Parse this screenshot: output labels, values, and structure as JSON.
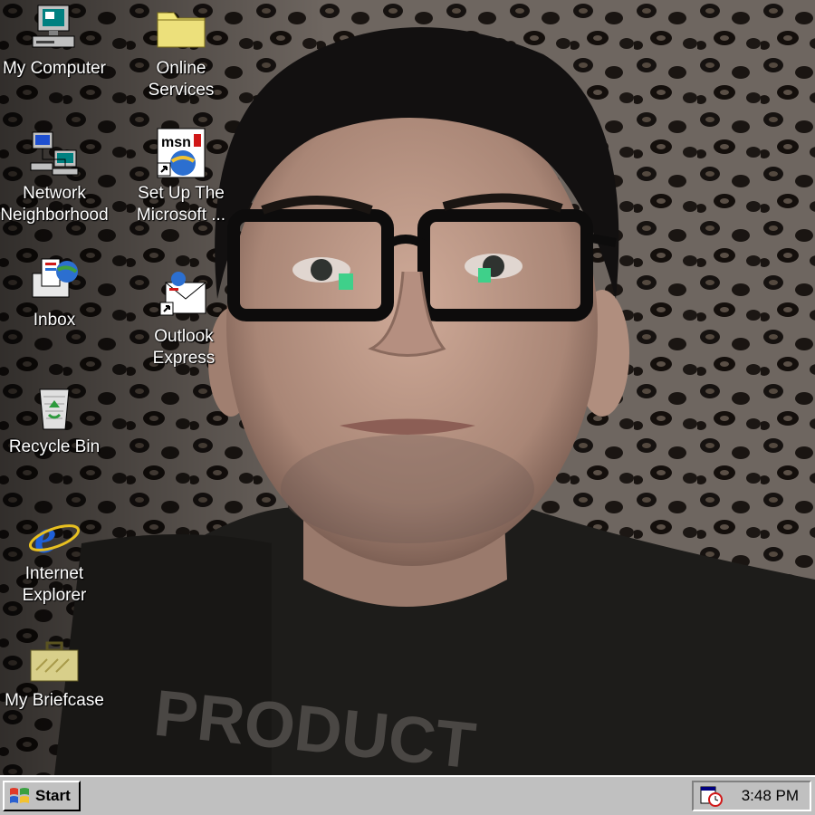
{
  "desktop": {
    "icons": [
      {
        "label_line1": "My Computer",
        "label_line2": "",
        "icon": "computer-icon"
      },
      {
        "label_line1": "Online",
        "label_line2": "Services",
        "icon": "folder-icon"
      },
      {
        "label_line1": "Network",
        "label_line2": "Neighborhood",
        "icon": "network-icon"
      },
      {
        "label_line1": "Set Up The",
        "label_line2": "Microsoft ...",
        "icon": "msn-icon"
      },
      {
        "label_line1": "Inbox",
        "label_line2": "",
        "icon": "inbox-icon"
      },
      {
        "label_line1": "Outlook",
        "label_line2": "Express",
        "icon": "outlook-express-icon"
      },
      {
        "label_line1": "Recycle Bin",
        "label_line2": "",
        "icon": "recycle-bin-icon"
      },
      {
        "label_line1": "Internet",
        "label_line2": "Explorer",
        "icon": "internet-explorer-icon"
      },
      {
        "label_line1": "My Briefcase",
        "label_line2": "",
        "icon": "briefcase-icon"
      }
    ],
    "wallpaper_shirt_text": "PRODUCT"
  },
  "taskbar": {
    "start_label": "Start",
    "clock": "3:48 PM",
    "tray_icon": "scheduler-icon"
  },
  "colors": {
    "taskbar": "#c0c0c0",
    "desktop_text": "#ffffff"
  }
}
